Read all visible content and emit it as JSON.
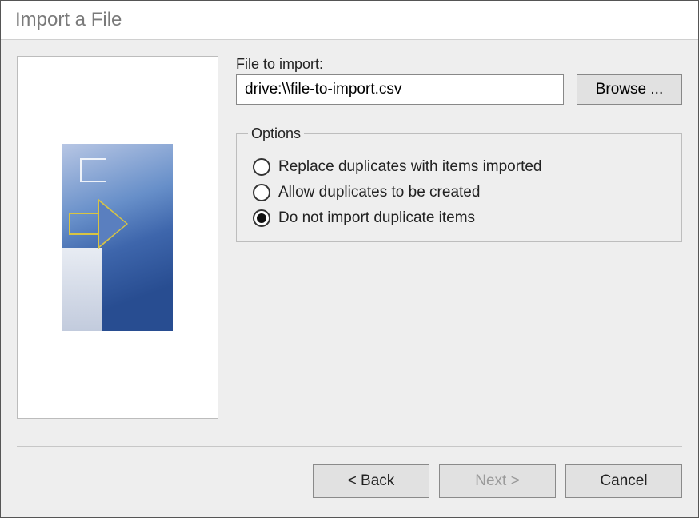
{
  "title": "Import a File",
  "file_label": "File to import:",
  "file_value": "drive:\\\\file-to-import.csv",
  "browse_label": "Browse ...",
  "options": {
    "legend": "Options",
    "items": [
      {
        "label": "Replace duplicates with items imported",
        "checked": false
      },
      {
        "label": "Allow duplicates to be created",
        "checked": false
      },
      {
        "label": "Do not import duplicate items",
        "checked": true
      }
    ]
  },
  "buttons": {
    "back": "< Back",
    "next": "Next >",
    "cancel": "Cancel",
    "next_enabled": false
  }
}
